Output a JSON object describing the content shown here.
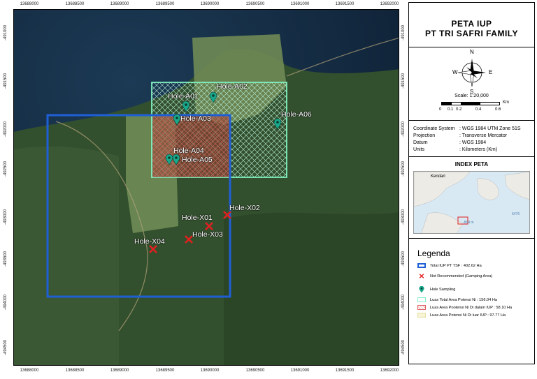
{
  "title": {
    "line1": "PETA IUP",
    "line2": "PT TRI SAFRI FAMILY"
  },
  "x_ticks": [
    "13688000",
    "13688500",
    "13689000",
    "13689500",
    "13690000",
    "13690500",
    "13691000",
    "13691500",
    "13692000"
  ],
  "y_ticks": [
    "-491000",
    "-491500",
    "-492000",
    "-492500",
    "-493000",
    "-493500",
    "-494000",
    "-494500"
  ],
  "compass": {
    "n": "N",
    "s": "S",
    "e": "E",
    "w": "W"
  },
  "scale": {
    "text": "Scale: 1:20,000",
    "unit": "Km",
    "labels": [
      "0",
      "0.1",
      "0.2",
      "0.4",
      "0.6"
    ]
  },
  "coordinate_system": {
    "rows": [
      {
        "key": "Coordinate System",
        "value": ": WGS 1984 UTM Zone 51S"
      },
      {
        "key": "Projection",
        "value": ": Transverse Mercator"
      },
      {
        "key": "Datum",
        "value": ": WGS 1984"
      },
      {
        "key": "Units",
        "value": ": Kilometers (Km)"
      }
    ]
  },
  "index_map": {
    "title": "INDEX PETA",
    "place": "Kendari",
    "sea_label": "6476",
    "depth_label": "-864 m"
  },
  "legend": {
    "title": "Legenda",
    "items": [
      {
        "label": "Total IUP PT TSF : 402.62 Ha",
        "color": "#1f5fd6"
      },
      {
        "label": "Not Recommended (Gamping Area)",
        "color": "#e02020"
      },
      {
        "label": "Hole Sampling",
        "color": "#1aa88a"
      },
      {
        "label": "Luas Total Area Potensi Ni : 156.04 Ha",
        "color": "#7ff0c0"
      },
      {
        "label": "Luas Area Pootensi Ni Di dalam IUP : 58.10 Ha",
        "color": "#e06060"
      },
      {
        "label": "Luas Area Potensi Ni Di luar IUP : 97.77 Ha",
        "color": "#f2eec0"
      }
    ]
  },
  "holes": {
    "sampling": [
      "Hole-A01",
      "Hole-A02",
      "Hole-A03",
      "Hole-A04",
      "Hole-A05",
      "Hole-A06"
    ],
    "not_recommended": [
      "Hole-X01",
      "Hole-X02",
      "Hole-X03",
      "Hole-X04"
    ]
  }
}
